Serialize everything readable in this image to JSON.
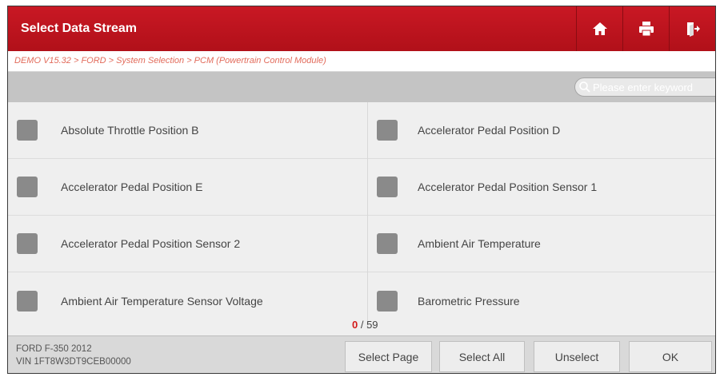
{
  "header": {
    "title": "Select Data Stream",
    "home_icon": "home-icon",
    "print_icon": "print-icon",
    "exit_icon": "exit-icon"
  },
  "breadcrumb": "DEMO V15.32 > FORD > System Selection > PCM (Powertrain Control Module)",
  "search": {
    "placeholder": "Please enter keyword"
  },
  "items": [
    {
      "label": "Absolute Throttle Position B",
      "checked": false
    },
    {
      "label": "Accelerator Pedal Position D",
      "checked": false
    },
    {
      "label": "Accelerator Pedal Position E",
      "checked": false
    },
    {
      "label": "Accelerator Pedal Position Sensor 1",
      "checked": false
    },
    {
      "label": "Accelerator Pedal Position Sensor 2",
      "checked": false
    },
    {
      "label": "Ambient Air Temperature",
      "checked": false
    },
    {
      "label": "Ambient Air Temperature Sensor Voltage",
      "checked": false
    },
    {
      "label": "Barometric Pressure",
      "checked": false
    }
  ],
  "counter": {
    "selected": "0",
    "separator": " / ",
    "total": "59"
  },
  "footer": {
    "vehicle_model": "FORD F-350 2012",
    "vin": "VIN 1FT8W3DT9CEB00000",
    "buttons": {
      "select_page": "Select Page",
      "select_all": "Select All",
      "unselect": "Unselect",
      "ok": "OK"
    }
  },
  "colors": {
    "header_red": "#c0151f",
    "breadcrumb_text": "#e26b5b",
    "counter_selected": "#d31a1a",
    "checkbox_gray": "#8a8a8a"
  }
}
